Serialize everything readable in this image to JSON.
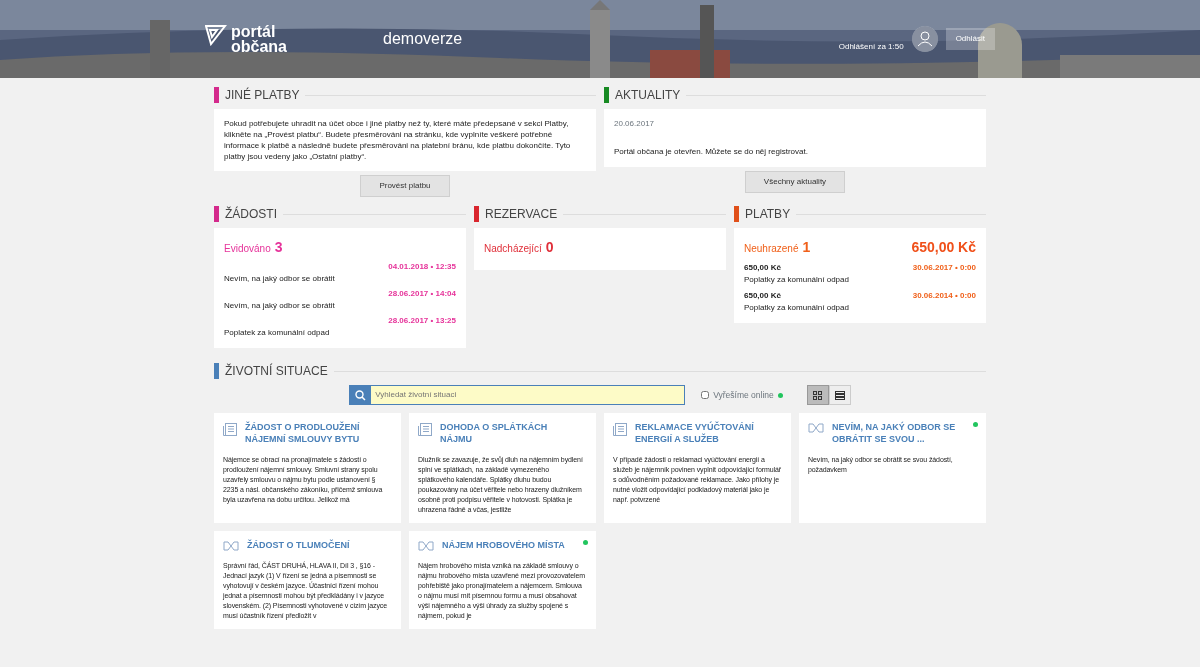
{
  "header": {
    "logo_line1": "portál",
    "logo_line2": "občana",
    "subtitle": "demoverze",
    "logout_timer": "Odhlášení za 1:50",
    "logout_button": "Odhlásit"
  },
  "other_payments": {
    "title": "JINÉ PLATBY",
    "color": "#d42a8c",
    "text": "Pokud potřebujete uhradit na účet obce i jiné platby než ty, které máte předepsané v sekci Platby, klikněte na „Provést platbu“. Budete přesměrováni na stránku, kde vyplníte veškeré potřebné informace k platbě a následně budete přesměrováni na platební bránu, kde platbu dokončíte. Tyto platby jsou vedeny jako „Ostatní platby“.",
    "button": "Provést platbu"
  },
  "news": {
    "title": "AKTUALITY",
    "color": "#178a23",
    "date": "20.06.2017",
    "text": "Portál občana je otevřen. Můžete se do něj registrovat.",
    "button": "Všechny aktuality"
  },
  "requests": {
    "title": "ŽÁDOSTI",
    "color": "#d42a8c",
    "label": "Evidováno",
    "count": "3",
    "items": [
      {
        "date": "04.01.2018 • 12:35",
        "text": "Nevím, na jaký odbor se obrátit"
      },
      {
        "date": "28.06.2017 • 14:04",
        "text": "Nevím, na jaký odbor se obrátit"
      },
      {
        "date": "28.06.2017 • 13:25",
        "text": "Poplatek za komunální odpad"
      }
    ]
  },
  "reservations": {
    "title": "REZERVACE",
    "color": "#d9262e",
    "label": "Nadcházející",
    "count": "0"
  },
  "payments": {
    "title": "PLATBY",
    "color": "#e0501a",
    "label": "Neuhrazené",
    "count": "1",
    "total": "650,00 Kč",
    "items": [
      {
        "amount": "650,00 Kč",
        "date": "30.06.2017 • 0:00",
        "text": "Poplatky za komunální odpad"
      },
      {
        "amount": "650,00 Kč",
        "date": "30.06.2014 • 0:00",
        "text": "Poplatky za komunální odpad"
      }
    ]
  },
  "life_situations": {
    "title": "ŽIVOTNÍ SITUACE",
    "color": "#4a80b8",
    "search_placeholder": "Vyhledat životní situaci",
    "online_filter": {
      "label": "Vyřešíme online",
      "checked": false
    },
    "views": [
      {
        "kind": "grid",
        "selected": true
      },
      {
        "kind": "list",
        "selected": false
      }
    ],
    "cards": [
      {
        "kind": "document",
        "online": false,
        "title": "ŽÁDOST O PRODLOUŽENÍ NÁJEMNÍ SMLOUVY BYTU",
        "text": "Nájemce se obrací na pronajímatele s žádostí o prodloužení nájemní smlouvy. Smluvní strany spolu uzavřely smlouvu o nájmu bytu podle ustanovení § 2235 a násl. občanského zákoníku, přičemž smlouva byla uzavřena na dobu určitou. Jelikož má"
      },
      {
        "kind": "document",
        "online": false,
        "title": "DOHODA O SPLÁTKÁCH NÁJMU",
        "text": "Dlužník se zavazuje, že svůj dluh na nájemním bydlení splní ve splátkách, na základě vymezeného splátkového kalendáře. Splátky dluhu budou poukazovány na účet věřitele nebo hrazeny dlužníkem osobně proti podpisu věřitele v hotovosti. Splátka je uhrazena řádně a včas, jestliže"
      },
      {
        "kind": "document",
        "online": false,
        "title": "REKLAMACE VYÚČTOVÁNÍ ENERGIÍ A SLUŽEB",
        "text": "V případě žádosti o reklamaci vyúčtování energií a služeb je nájemník povinen vyplnit odpovídající formulář s odůvodněním požadované reklamace. Jako přílohy je nutné vložit odpovídající podkladový materiál jako je např. potvrzené"
      },
      {
        "kind": "link",
        "online": true,
        "title": "NEVÍM, NA JAKÝ ODBOR SE OBRÁTIT SE SVOU ...",
        "text": "Nevím, na jaký odbor se obrátit se svou žádostí, požadavkem"
      },
      {
        "kind": "link",
        "online": false,
        "title": "ŽÁDOST O TLUMOČENÍ",
        "text": "Správní řád, ČÁST DRUHÁ, HLAVA II, Díl 3 , §16 - Jednací jazyk (1) V řízení se jedná a písemnosti se vyhotovují v českém jazyce. Účastníci řízení mohou jednat a písemnosti mohou být předkládány i v jazyce slovenském. (2) Písemnosti vyhotovené v cizím jazyce musí účastník řízení předložit v"
      },
      {
        "kind": "link",
        "online": true,
        "title": "NÁJEM HROBOVÉHO MÍSTA",
        "text": "Nájem hrobového místa vzniká na základě smlouvy o nájmu hrobového místa uzavřené mezi provozovatelem pohřebiště jako pronajímatelem a nájemcem. Smlouva o nájmu musí mít písemnou formu a musí obsahovat výši nájemného a výši úhrady za služby spojené s nájmem, pokud je"
      }
    ]
  }
}
